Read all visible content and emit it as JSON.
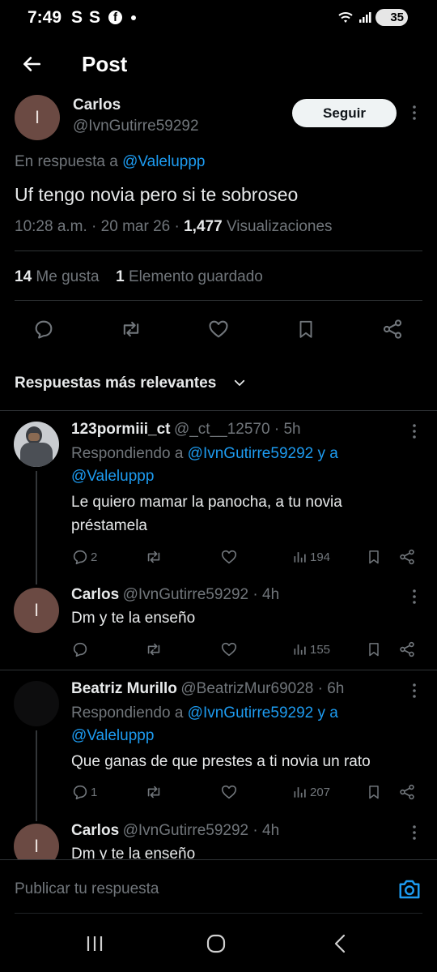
{
  "status_bar": {
    "time": "7:49",
    "notif_icons": [
      "S",
      "S"
    ],
    "battery": "35"
  },
  "header": {
    "title": "Post"
  },
  "post": {
    "author_name": "Carlos",
    "author_handle": "@IvnGutirre59292",
    "avatar_letter": "I",
    "follow_label": "Seguir",
    "reply_prefix": "En respuesta a",
    "reply_to": "@Valeluppp",
    "text": "Uf tengo novia pero si te sobroseo",
    "time": "10:28 a.m.",
    "date": "20 mar 26",
    "views_count": "1,477",
    "views_label": "Visualizaciones",
    "likes_count": "14",
    "likes_label": "Me gusta",
    "saves_count": "1",
    "saves_label": "Elemento guardado"
  },
  "sort": {
    "label": "Respuestas más relevantes"
  },
  "replies": [
    {
      "name": "123pormiii_ct",
      "handle": "@_ct__12570",
      "time": "5h",
      "replying_prefix": "Respondiendo a",
      "replying_to_line1": "@IvnGutirre59292 y a",
      "replying_to_line2": "@Valeluppp",
      "text_line1": "Le quiero mamar la panocha, a tu novia",
      "text_line2": "préstamela",
      "reply_count": "2",
      "views": "194"
    },
    {
      "name": "Carlos",
      "handle": "@IvnGutirre59292",
      "time": "4h",
      "avatar_letter": "I",
      "text_line1": "Dm y te la enseño",
      "views": "155"
    },
    {
      "name": "Beatriz Murillo",
      "handle": "@BeatrizMur69028",
      "time": "6h",
      "replying_prefix": "Respondiendo a",
      "replying_to_line1": "@IvnGutirre59292 y a",
      "replying_to_line2": "@Valeluppp",
      "text_line1": "Que ganas de que prestes a ti novia un rato",
      "reply_count": "1",
      "views": "207"
    },
    {
      "name": "Carlos",
      "handle": "@IvnGutirre59292",
      "time": "4h",
      "avatar_letter": "I",
      "text_line1": "Dm y te la enseño"
    }
  ],
  "composer": {
    "placeholder": "Publicar tu respuesta"
  },
  "colors": {
    "accent": "#1d9bf0",
    "background": "#000000",
    "muted": "#71767b",
    "avatar_bg": "#6b4a43"
  }
}
